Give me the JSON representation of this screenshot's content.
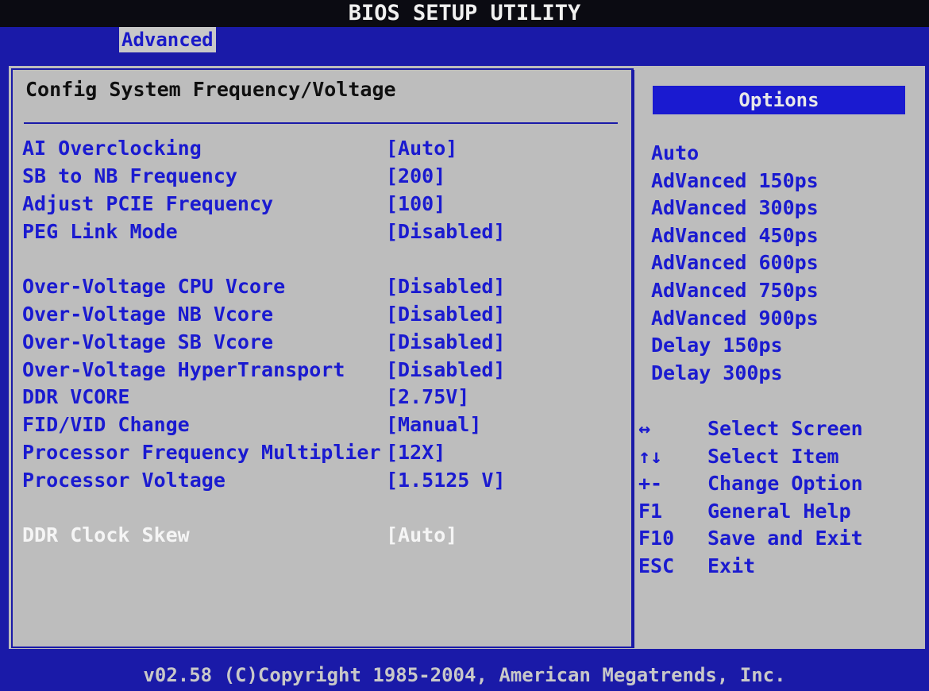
{
  "header": {
    "title": "BIOS SETUP UTILITY"
  },
  "menu": {
    "active_tab": "Advanced"
  },
  "main": {
    "section_title": "Config System Frequency/Voltage",
    "settings": [
      {
        "label": "AI Overclocking",
        "value": "[Auto]"
      },
      {
        "label": "SB to NB Frequency",
        "value": "[200]"
      },
      {
        "label": "Adjust PCIE Frequency",
        "value": "[100]"
      },
      {
        "label": "PEG Link Mode",
        "value": "[Disabled]"
      },
      {
        "label": "Over-Voltage CPU Vcore",
        "value": "[Disabled]"
      },
      {
        "label": "Over-Voltage NB Vcore",
        "value": "[Disabled]"
      },
      {
        "label": "Over-Voltage SB Vcore",
        "value": "[Disabled]"
      },
      {
        "label": "Over-Voltage HyperTransport",
        "value": "[Disabled]"
      },
      {
        "label": "DDR VCORE",
        "value": "[2.75V]"
      },
      {
        "label": "FID/VID Change",
        "value": "[Manual]"
      },
      {
        "label": "Processor Frequency Multiplier",
        "value": "[12X]"
      },
      {
        "label": "Processor Voltage",
        "value": "[1.5125 V]"
      },
      {
        "label": "DDR Clock Skew",
        "value": "[Auto]"
      }
    ],
    "selected_setting": "DDR Clock Skew"
  },
  "options": {
    "header": "Options",
    "items": [
      "Auto",
      "AdVanced 150ps",
      "AdVanced 300ps",
      "AdVanced 450ps",
      "AdVanced 600ps",
      "AdVanced 750ps",
      "AdVanced 900ps",
      "Delay 150ps",
      "Delay 300ps"
    ]
  },
  "help": [
    {
      "key": "↔",
      "desc": "Select Screen"
    },
    {
      "key": "↑↓",
      "desc": "Select Item"
    },
    {
      "key": "+-",
      "desc": "Change Option"
    },
    {
      "key": "F1",
      "desc": "General Help"
    },
    {
      "key": "F10",
      "desc": "Save and Exit"
    },
    {
      "key": "ESC",
      "desc": "Exit"
    }
  ],
  "footer": {
    "text": "v02.58 (C)Copyright 1985-2004, American Megatrends, Inc."
  },
  "colors": {
    "background_blue": "#1a1aa8",
    "panel_gray": "#bdbdbd",
    "text_blue": "#1a1ad0",
    "highlight_white": "#f5f5f5"
  }
}
